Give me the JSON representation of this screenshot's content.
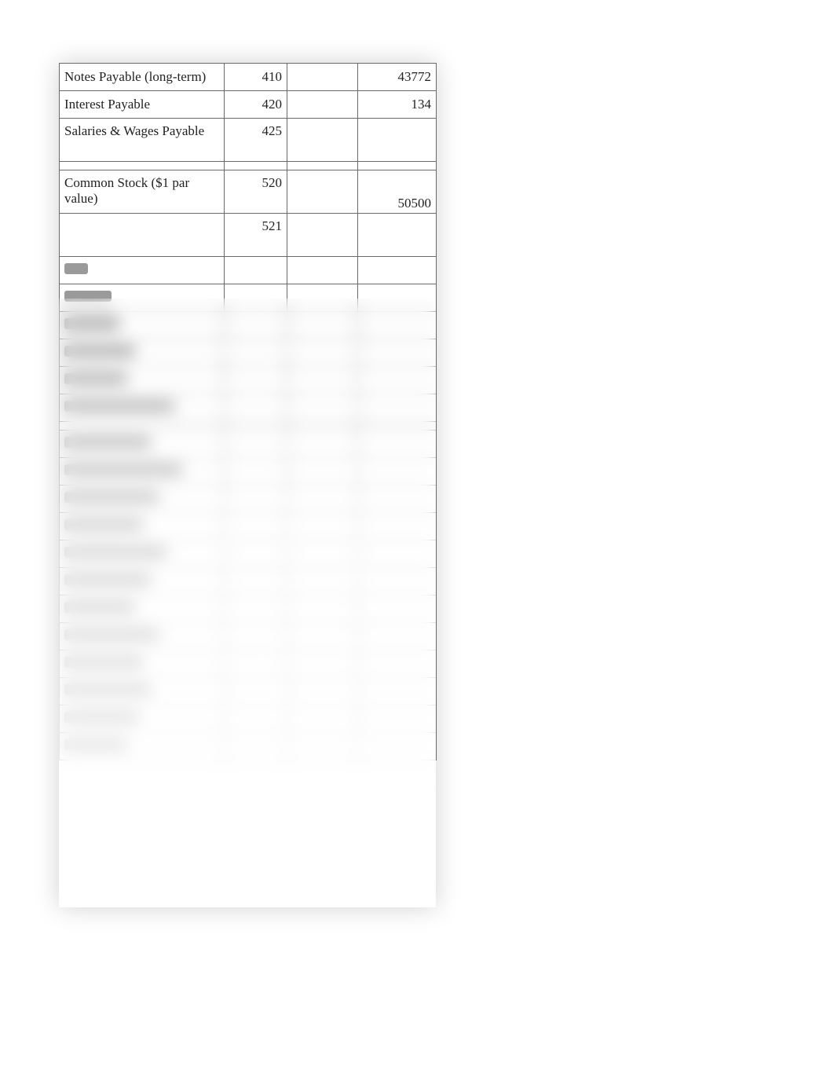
{
  "rows": [
    {
      "account": "Notes Payable (long-term)",
      "num": "410",
      "dr": "",
      "cr": "43772",
      "tall": false
    },
    {
      "account": "Interest Payable",
      "num": "420",
      "dr": "",
      "cr": "134",
      "tall": false
    },
    {
      "account": "Salaries & Wages Payable",
      "num": "425",
      "dr": "",
      "cr": "",
      "tall": true
    },
    {
      "spacer": true
    },
    {
      "account": "Common Stock ($1 par value)",
      "num": "520",
      "dr": "",
      "cr": "50500",
      "tall": true
    },
    {
      "account": "",
      "num": "521",
      "dr": "",
      "cr": "",
      "tall": true
    }
  ]
}
